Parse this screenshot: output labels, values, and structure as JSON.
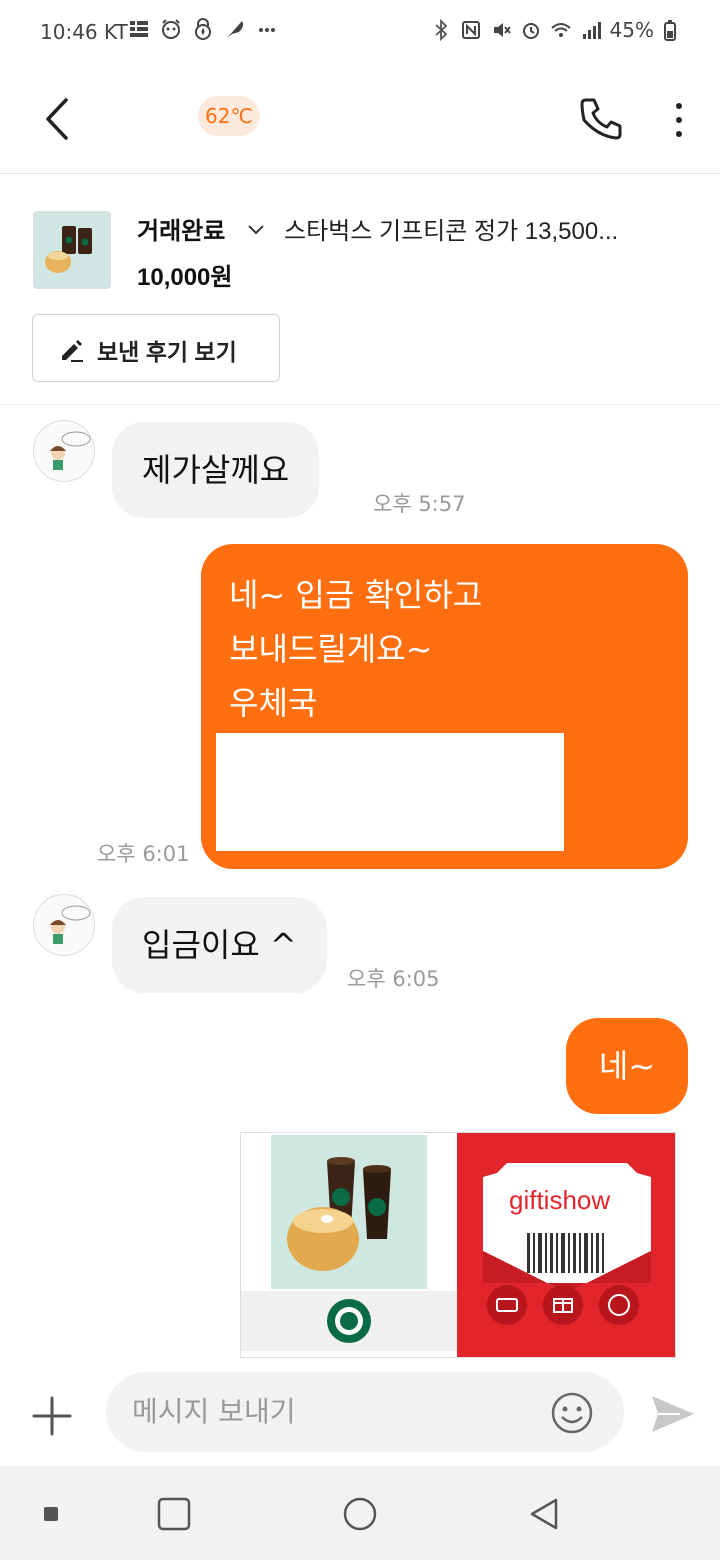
{
  "status_bar": {
    "time": "10:46 KT",
    "battery": "45%",
    "left_icons": [
      "notification-list-icon",
      "alarm-app-icon",
      "fire-lock-icon",
      "feather-icon",
      "more-dots-icon"
    ],
    "right_icons": [
      "bluetooth-icon",
      "nfc-icon",
      "mute-icon",
      "alarm-icon",
      "wifi-icon",
      "signal-icon",
      "battery-icon"
    ]
  },
  "header": {
    "temperature": "62℃"
  },
  "product": {
    "status": "거래완료",
    "title": "스타벅스 기프티콘 정가 13,500...",
    "price": "10,000원",
    "review_button": "보낸 후기 보기"
  },
  "messages": [
    {
      "direction": "in",
      "text": "제가살께요",
      "time": "오후 5:57"
    },
    {
      "direction": "out",
      "lines": [
        "네~ 입금 확인하고",
        "보내드릴게요~",
        "우체국"
      ],
      "time": "오후 6:01"
    },
    {
      "direction": "in",
      "text": "입금이요 ^",
      "time": "오후 6:05"
    },
    {
      "direction": "out",
      "text": "네~"
    }
  ],
  "gift_image": {
    "brand": "giftishow"
  },
  "input": {
    "placeholder": "메시지 보내기"
  },
  "colors": {
    "accent": "#ff6f0f",
    "bubble_in": "#f1f2f4",
    "temp_bg": "#fde8dc",
    "giftishow_red": "#e2242b"
  }
}
